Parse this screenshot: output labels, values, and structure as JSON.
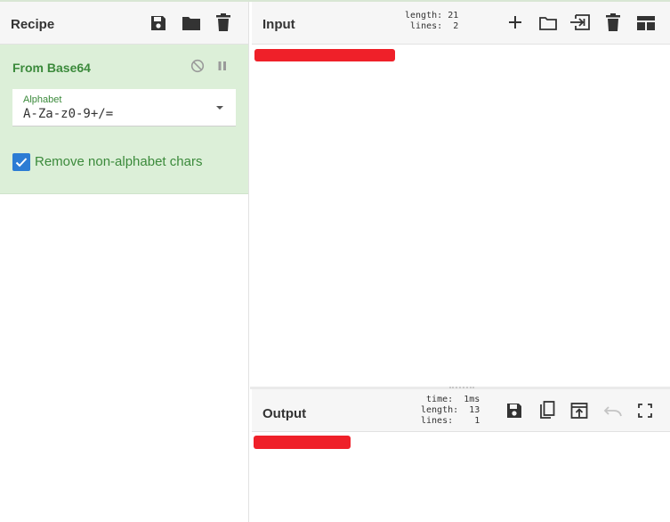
{
  "recipe": {
    "title": "Recipe",
    "icons": [
      "save-icon",
      "folder-icon",
      "trash-icon"
    ]
  },
  "operation": {
    "name": "From Base64",
    "controls": [
      "disable-icon",
      "pause-icon"
    ],
    "alphabet": {
      "label": "Alphabet",
      "value": "A-Za-z0-9+/="
    },
    "remove_non_alphabet": {
      "label": "Remove non-alphabet chars",
      "checked": true
    }
  },
  "input": {
    "title": "Input",
    "stats": {
      "length_label": "length:",
      "length": "21",
      "lines_label": "lines:",
      "lines": "2"
    },
    "icons": [
      "plus-icon",
      "folder-icon",
      "import-icon",
      "trash-icon",
      "layout-icon"
    ],
    "content_redacted": true
  },
  "output": {
    "title": "Output",
    "stats": {
      "time_label": "time:",
      "time": "1ms",
      "length_label": "length:",
      "length": "13",
      "lines_label": "lines:",
      "lines": "1"
    },
    "icons": [
      "save-icon",
      "copy-icon",
      "replace-input-icon",
      "undo-icon",
      "fullscreen-icon"
    ],
    "content_redacted": true
  },
  "colors": {
    "accent_green": "#3b8a3b",
    "operation_bg": "#dcefd8",
    "checkbox_blue": "#2c7cd4",
    "redaction_red": "#ef2029"
  }
}
